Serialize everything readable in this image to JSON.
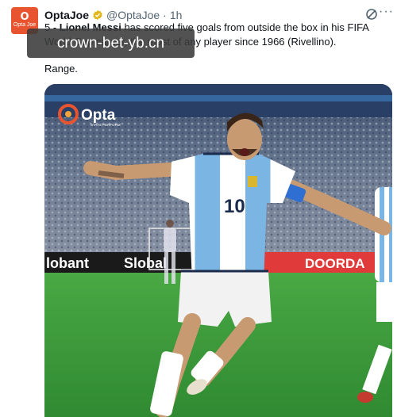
{
  "tweet": {
    "author_name": "OptaJoe",
    "handle": "@OptaJoe",
    "separator": "·",
    "time": "1h",
    "avatar_text": "O",
    "avatar_subtext": "Opta Joe",
    "text_prefix": "5 - ",
    "text_bold": "Lionel Messi",
    "text_body": " has scored five goals from outside the box in his FIFA World Cup career, the most of any player since 1966 (Rivellino).",
    "text_extra": "Range."
  },
  "watermark": {
    "text": "crown-bet-yb.cn"
  },
  "media": {
    "logo_text": "Opta",
    "logo_sub": "STATS PERFORM",
    "board_left": "lobant",
    "board_mid": "Slobal",
    "board_right": "DOORDA",
    "jersey_number": "10"
  },
  "colors": {
    "avatar_bg": "#e8542f",
    "verified": "#e2b719",
    "text_muted": "#536471",
    "pitch": "#3f9a3a",
    "board_red": "#e03a3a"
  },
  "icons": {
    "verified": "verified-badge-icon",
    "grok": "grok-icon",
    "more": "more-icon"
  }
}
